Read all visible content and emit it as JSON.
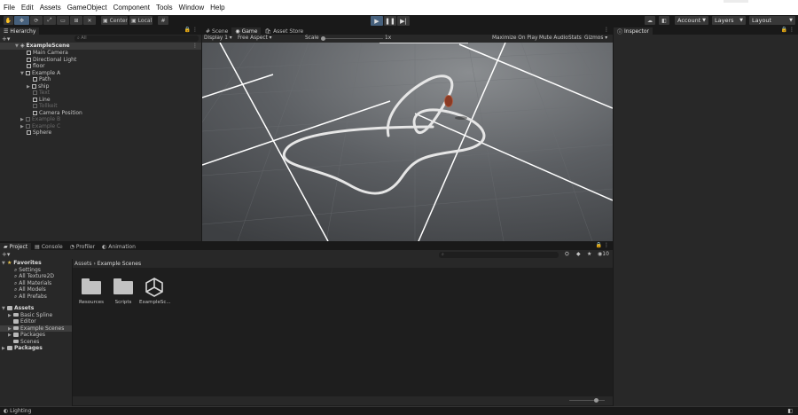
{
  "menu": [
    "File",
    "Edit",
    "Assets",
    "GameObject",
    "Component",
    "Tools",
    "Window",
    "Help"
  ],
  "toolbar": {
    "pivot_label": "Center",
    "space_label": "Local",
    "account_label": "Account",
    "layers_label": "Layers",
    "layout_label": "Layout"
  },
  "hierarchy": {
    "tab_label": "Hierarchy",
    "search_placeholder": "All",
    "scene_name": "ExampleScene",
    "items": [
      {
        "label": "Main Camera",
        "active": true
      },
      {
        "label": "Directional Light",
        "active": true
      },
      {
        "label": "floor",
        "active": true
      },
      {
        "label": "Example A",
        "active": true
      },
      {
        "label": "Path",
        "active": true
      },
      {
        "label": "ship",
        "active": true
      },
      {
        "label": "Text",
        "active": false
      },
      {
        "label": "Line",
        "active": true
      },
      {
        "label": "Tollkeit",
        "active": false
      },
      {
        "label": "Camera Position",
        "active": true
      },
      {
        "label": "Example B",
        "active": false
      },
      {
        "label": "Example C",
        "active": false
      },
      {
        "label": "Sphere",
        "active": true
      }
    ]
  },
  "center_tabs": [
    "Scene",
    "Game",
    "Asset Store"
  ],
  "game_bar": {
    "display": "Display 1",
    "aspect": "Free Aspect",
    "scale_label": "Scale",
    "scale_value": "1x",
    "maximize": "Maximize On Play",
    "mute": "Mute Audio",
    "stats": "Stats",
    "gizmos": "Gizmos"
  },
  "inspector": {
    "tab_label": "Inspector"
  },
  "bottom_tabs": [
    "Project",
    "Console",
    "Profiler",
    "Animation"
  ],
  "project": {
    "favorites_label": "Favorites",
    "favorites": [
      "Settings",
      "All Texture2D",
      "All Materials",
      "All Models",
      "All Prefabs"
    ],
    "assets_label": "Assets",
    "asset_folders": [
      "Basic Spline",
      "Editor",
      "Example Scenes",
      "Packages",
      "Scenes"
    ],
    "packages_label": "Packages",
    "breadcrumb_root": "Assets",
    "breadcrumb_current": "Example Scenes",
    "hidden_count": "10",
    "grid_items": [
      {
        "label": "Resources",
        "kind": "folder"
      },
      {
        "label": "Scripts",
        "kind": "folder"
      },
      {
        "label": "ExampleSc...",
        "kind": "unity"
      }
    ]
  },
  "status": {
    "left": "Lighting"
  },
  "colors": {
    "accent_play": "#46607c",
    "selection": "#2c5d87",
    "panel": "#282828",
    "background": "#191919"
  }
}
